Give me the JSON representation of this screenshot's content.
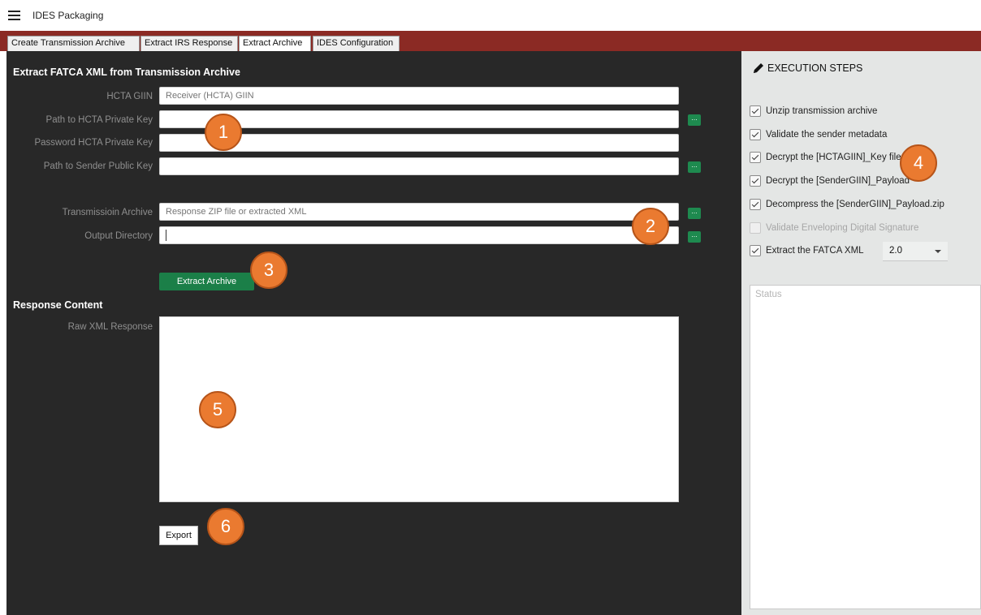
{
  "app": {
    "title": "IDES Packaging"
  },
  "tabs": [
    {
      "label": "Create Transmission Archive"
    },
    {
      "label": "Extract IRS Response"
    },
    {
      "label": "Extract Archive"
    },
    {
      "label": "IDES Configuration"
    }
  ],
  "form": {
    "title": "Extract FATCA XML from Transmission Archive",
    "hcta_giin": {
      "label": "HCTA GIIN",
      "placeholder": "Receiver (HCTA) GIIN",
      "value": ""
    },
    "hcta_private_key": {
      "label": "Path to HCTA Private Key",
      "value": ""
    },
    "hcta_password": {
      "label": "Password HCTA Private Key",
      "value": ""
    },
    "sender_public_key": {
      "label": "Path to Sender Public Key",
      "value": ""
    },
    "transmission_archive": {
      "label": "Transmissioin Archive",
      "placeholder": "Response ZIP file or extracted XML",
      "value": ""
    },
    "output_directory": {
      "label": "Output Directory",
      "value": ""
    },
    "browse_label": "...",
    "extract_button": "Extract Archive"
  },
  "response": {
    "title": "Response Content",
    "raw_label": "Raw XML Response",
    "value": "",
    "export_button": "Export"
  },
  "steps": {
    "title": "EXECUTION STEPS",
    "items": [
      {
        "label": "Unzip transmission archive",
        "checked": true,
        "enabled": true
      },
      {
        "label": "Validate the sender metadata",
        "checked": true,
        "enabled": true
      },
      {
        "label": "Decrypt the [HCTAGIIN]_Key file",
        "checked": true,
        "enabled": true
      },
      {
        "label": "Decrypt the [SenderGIIN]_Payload",
        "checked": true,
        "enabled": true
      },
      {
        "label": "Decompress the [SenderGIIN]_Payload.zip",
        "checked": true,
        "enabled": true
      },
      {
        "label": "Validate Enveloping Digital Signature",
        "checked": false,
        "enabled": false
      },
      {
        "label": "Extract the FATCA XML",
        "checked": true,
        "enabled": true
      }
    ],
    "version": "2.0",
    "status_placeholder": "Status"
  },
  "markers": [
    "1",
    "2",
    "3",
    "4",
    "5",
    "6"
  ]
}
